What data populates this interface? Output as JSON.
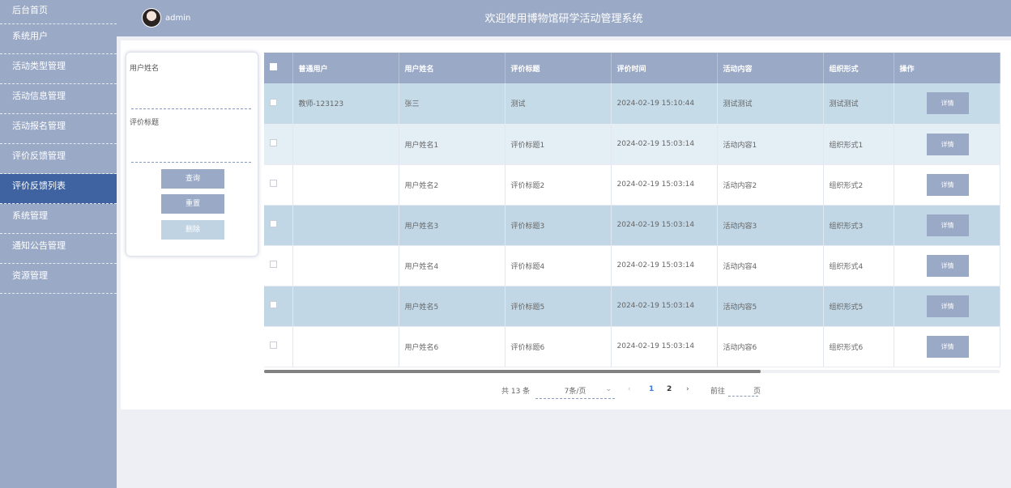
{
  "app": {
    "title": "欢迎使用博物馆研学活动管理系统",
    "user": "admin"
  },
  "sidebar": {
    "items": [
      {
        "label": "后台首页"
      },
      {
        "label": "系统用户"
      },
      {
        "label": "活动类型管理"
      },
      {
        "label": "活动信息管理"
      },
      {
        "label": "活动报名管理"
      },
      {
        "label": "评价反馈管理"
      },
      {
        "label": "评价反馈列表"
      },
      {
        "label": "系统管理"
      },
      {
        "label": "通知公告管理"
      },
      {
        "label": "资源管理"
      }
    ]
  },
  "search": {
    "username_label": "用户姓名",
    "title_label": "评价标题",
    "query_button": "查询",
    "reset_button": "重置",
    "delete_button": "删除"
  },
  "table": {
    "columns": [
      "普通用户",
      "用户姓名",
      "评价标题",
      "评价时间",
      "活动内容",
      "组织形式",
      "操作"
    ],
    "rows": [
      [
        "教师-123123",
        "张三",
        "测试",
        "2024-02-19 15:10:44",
        "测试测试",
        "测试测试"
      ],
      [
        "",
        "用户姓名1",
        "评价标题1",
        "2024-02-19 15:03:14",
        "活动内容1",
        "组织形式1"
      ],
      [
        "",
        "用户姓名2",
        "评价标题2",
        "2024-02-19 15:03:14",
        "活动内容2",
        "组织形式2"
      ],
      [
        "",
        "用户姓名3",
        "评价标题3",
        "2024-02-19 15:03:14",
        "活动内容3",
        "组织形式3"
      ],
      [
        "",
        "用户姓名4",
        "评价标题4",
        "2024-02-19 15:03:14",
        "活动内容4",
        "组织形式4"
      ],
      [
        "",
        "用户姓名5",
        "评价标题5",
        "2024-02-19 15:03:14",
        "活动内容5",
        "组织形式5"
      ],
      [
        "",
        "用户姓名6",
        "评价标题6",
        "2024-02-19 15:03:14",
        "活动内容6",
        "组织形式6"
      ]
    ],
    "detail_label": "详情"
  },
  "pagination": {
    "total": "共 13 条",
    "page_size": "7条/页",
    "pages": [
      "1",
      "2"
    ],
    "current_page": "1",
    "goto_prefix": "前往",
    "goto_suffix": "页"
  },
  "colors": {
    "sidebar": "#9aa9c6",
    "active": "#3e63a0",
    "header": "#9aa9c6"
  }
}
